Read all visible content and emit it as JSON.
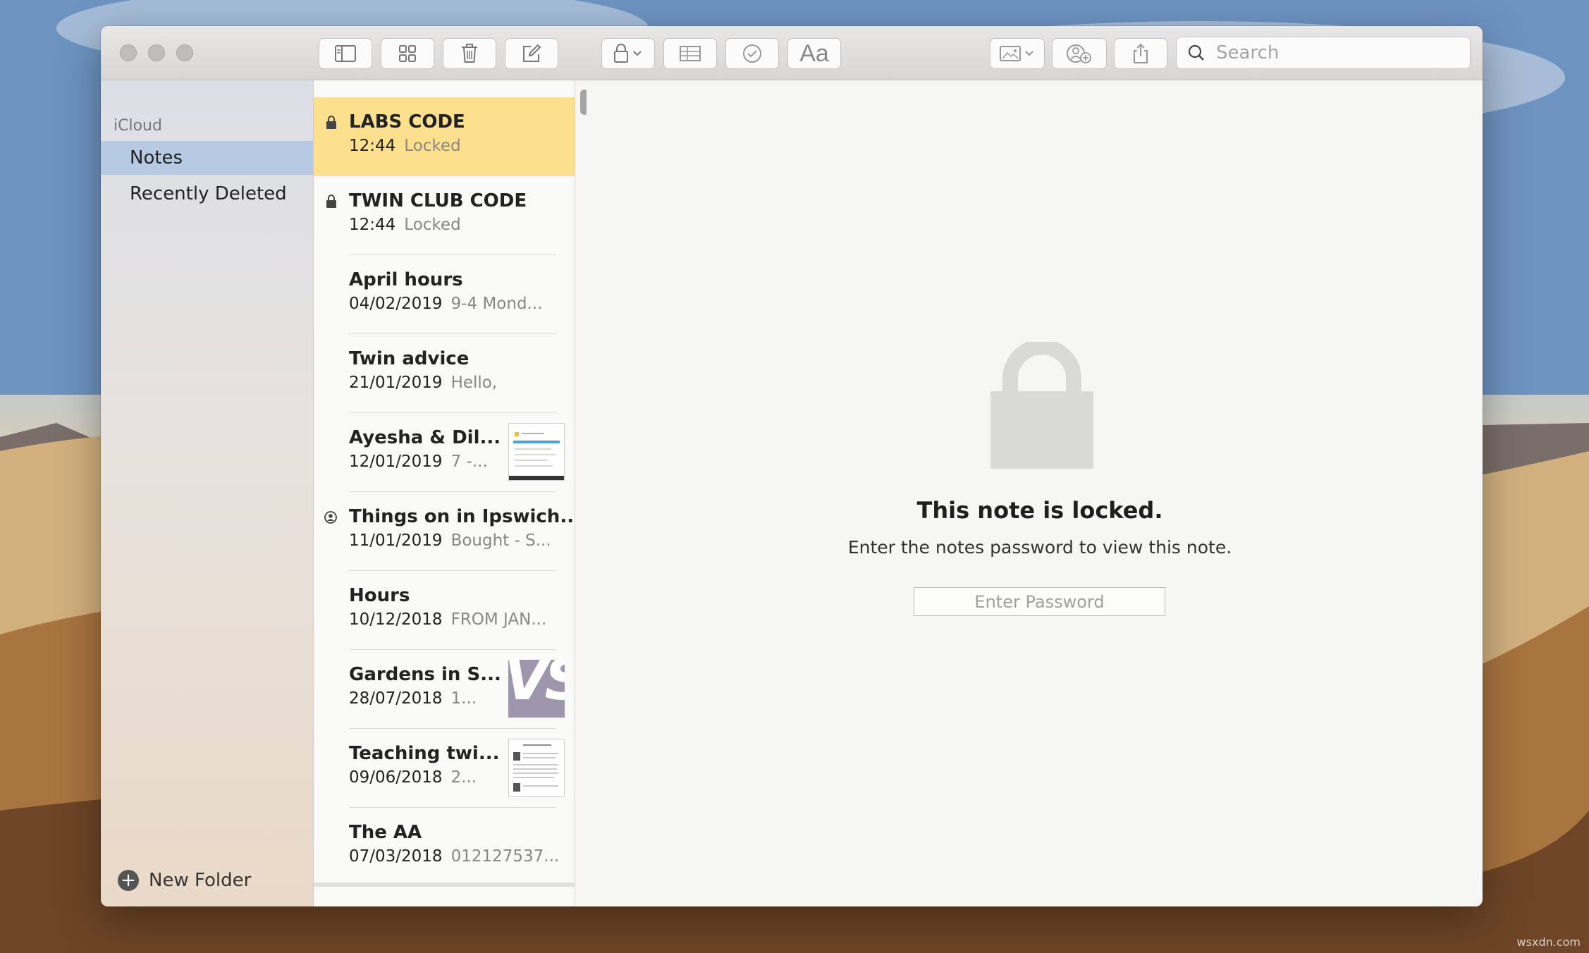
{
  "toolbar": {
    "search_placeholder": "Search",
    "format_label": "Aa"
  },
  "sidebar": {
    "section": "iCloud",
    "items": [
      {
        "label": "Notes",
        "selected": true
      },
      {
        "label": "Recently Deleted",
        "selected": false
      }
    ],
    "new_folder": "New Folder"
  },
  "notes": [
    {
      "title": "LABS CODE",
      "date": "12:44",
      "snippet": "Locked",
      "locked": true,
      "selected": true
    },
    {
      "title": "TWIN CLUB CODE",
      "date": "12:44",
      "snippet": "Locked",
      "locked": true
    },
    {
      "title": "April hours",
      "date": "04/02/2019",
      "snippet": "9-4 Mond..."
    },
    {
      "title": "Twin advice",
      "date": "21/01/2019",
      "snippet": "Hello,"
    },
    {
      "title": "Ayesha & Dil...",
      "date": "12/01/2019",
      "snippet": "7 -...",
      "thumb": "document"
    },
    {
      "title": "Things on in Ipswich...",
      "date": "11/01/2019",
      "snippet": "Bought - S...",
      "shared": true
    },
    {
      "title": "Hours",
      "date": "10/12/2018",
      "snippet": "FROM JAN..."
    },
    {
      "title": "Gardens in S...",
      "date": "28/07/2018",
      "snippet": "1...",
      "thumb": "logo",
      "thumb_text": "VS"
    },
    {
      "title": "Teaching twi...",
      "date": "09/06/2018",
      "snippet": "2...",
      "thumb": "document"
    },
    {
      "title": "The AA",
      "date": "07/03/2018",
      "snippet": "012127537..."
    }
  ],
  "content": {
    "locked_title": "This note is locked.",
    "locked_subtitle": "Enter the notes password to view this note.",
    "password_placeholder": "Enter Password"
  },
  "watermark": "wsxdn.com",
  "colors": {
    "selected_note": "#fde08d",
    "selected_folder": "#b6cae3",
    "lock_graphic": "#d9d9d7"
  }
}
